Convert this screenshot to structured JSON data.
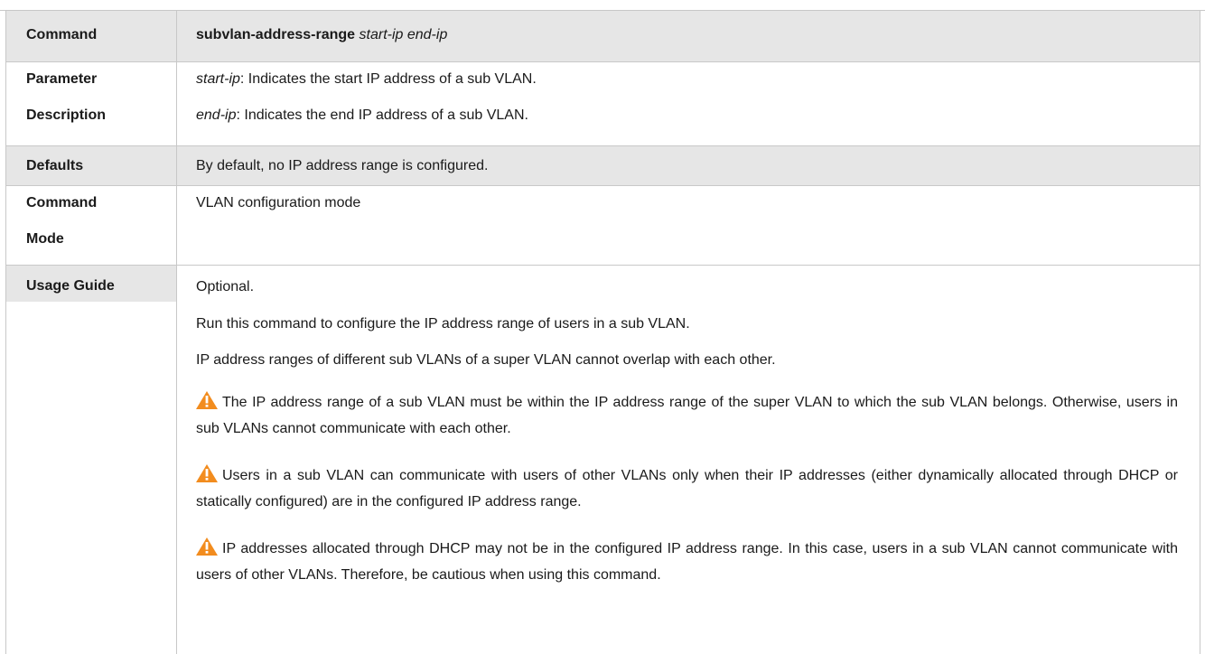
{
  "rows": {
    "command": {
      "label": "Command",
      "syntax_bold": "subvlan-address-range",
      "syntax_italic": "start-ip end-ip"
    },
    "parameter": {
      "label_line1": "Parameter",
      "label_line2": "Description",
      "p1_name": "start-ip",
      "p1_text": ": Indicates the start IP address of a sub VLAN.",
      "p2_name": "end-ip",
      "p2_text": ": Indicates the end IP address of a sub VLAN."
    },
    "defaults": {
      "label": "Defaults",
      "text": "By default, no IP address range is configured."
    },
    "mode": {
      "label_line1": "Command",
      "label_line2": "Mode",
      "text": "VLAN configuration mode"
    },
    "usage": {
      "label": "Usage Guide",
      "line1": "Optional.",
      "line2": "Run this command to configure the IP address range of users in a sub VLAN.",
      "line3": "IP address ranges of different sub VLANs of a super VLAN cannot overlap with each other.",
      "caution1": "The IP address range of a sub VLAN must be within the IP address range of the super VLAN to which the sub VLAN belongs. Otherwise, users in sub VLANs cannot communicate with each other.",
      "caution2": "Users in a sub VLAN can communicate with users of other VLANs only when their IP addresses (either dynamically allocated through DHCP or statically configured) are in the configured IP address range.",
      "caution3": "IP addresses allocated through DHCP may not be in the configured IP address range. In this case, users in a sub VLAN cannot communicate with users of other VLANs. Therefore, be cautious when using this command."
    }
  },
  "icons": {
    "caution": "warning-triangle-icon"
  },
  "colors": {
    "shade": "#e6e6e6",
    "border": "#c8c8c8",
    "warning": "#f28c1e"
  }
}
